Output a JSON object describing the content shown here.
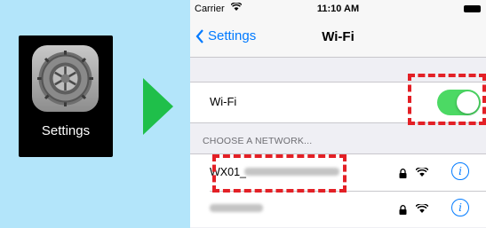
{
  "app_tile": {
    "label": "Settings"
  },
  "status_bar": {
    "carrier": "Carrier",
    "time": "11:10 AM"
  },
  "nav": {
    "back_label": "Settings",
    "title": "Wi-Fi"
  },
  "wifi_toggle": {
    "label": "Wi-Fi",
    "on": true
  },
  "section_header": "CHOOSE A NETWORK...",
  "networks": [
    {
      "name_prefix": "WX01_",
      "locked": true
    },
    {
      "name_prefix": "",
      "locked": true
    }
  ],
  "colors": {
    "background": "#b3e5fa",
    "arrow": "#1fbf4a",
    "ios_blue": "#007aff",
    "toggle_on": "#4cd964",
    "highlight": "#e32026"
  }
}
